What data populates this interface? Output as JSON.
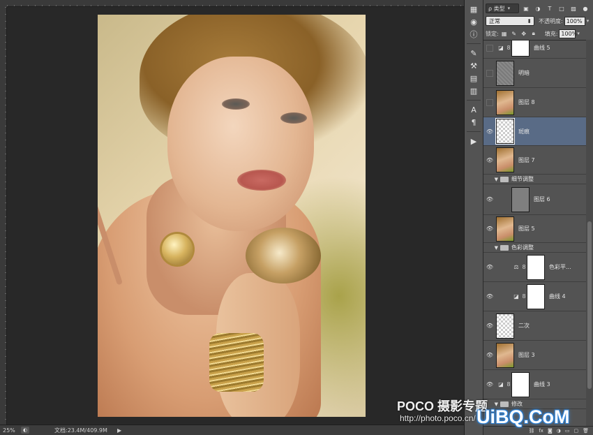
{
  "status_bar": {
    "zoom": "25%",
    "doc_info": "文档:23.4M/409.9M"
  },
  "layers_panel": {
    "filter": {
      "label": "ρ 类型"
    },
    "blend_mode": "正常",
    "opacity_label": "不透明度:",
    "opacity_value": "100%",
    "lock_label": "锁定:",
    "fill_label": "填充:",
    "fill_value": "100%",
    "layers": [
      {
        "name": "曲线 5",
        "type": "adjustment",
        "icon": "curves-icon",
        "thumb": "white",
        "visible": false
      },
      {
        "name": "明暗",
        "type": "pixel",
        "thumb": "texture",
        "visible": false
      },
      {
        "name": "图层 8",
        "type": "pixel",
        "thumb": "photo",
        "visible": false
      },
      {
        "name": "斑痕",
        "type": "pixel",
        "thumb": "transparent",
        "visible": true,
        "selected": true
      },
      {
        "name": "图层 7",
        "type": "pixel",
        "thumb": "photo",
        "visible": true
      },
      {
        "name": "细节调整",
        "type": "group",
        "expanded": true
      },
      {
        "name": "图层 6",
        "type": "pixel",
        "thumb": "gray",
        "visible": true
      },
      {
        "name": "图层 5",
        "type": "pixel",
        "thumb": "photo",
        "visible": true
      },
      {
        "name": "色彩调整",
        "type": "group",
        "expanded": true
      },
      {
        "name": "色彩平...",
        "type": "adjustment",
        "icon": "balance-icon",
        "thumb": "white",
        "visible": true
      },
      {
        "name": "曲线 4",
        "type": "adjustment",
        "icon": "curves-icon",
        "thumb": "white",
        "visible": true
      },
      {
        "name": "二次",
        "type": "pixel",
        "thumb": "transparent",
        "visible": true
      },
      {
        "name": "图层 3",
        "type": "pixel",
        "thumb": "photo",
        "visible": true
      },
      {
        "name": "曲线 3",
        "type": "adjustment",
        "icon": "curves-icon",
        "thumb": "white",
        "visible": true
      },
      {
        "name": "修改",
        "type": "group",
        "expanded": true
      }
    ]
  },
  "watermark": {
    "brand": "POCO 摄影专题",
    "url": "http://photo.poco.cn/",
    "site": "UiBQ.CoM"
  },
  "colors": {
    "selected_layer": "#596b86",
    "panel_bg": "#535353",
    "canvas_bg": "#282828"
  }
}
